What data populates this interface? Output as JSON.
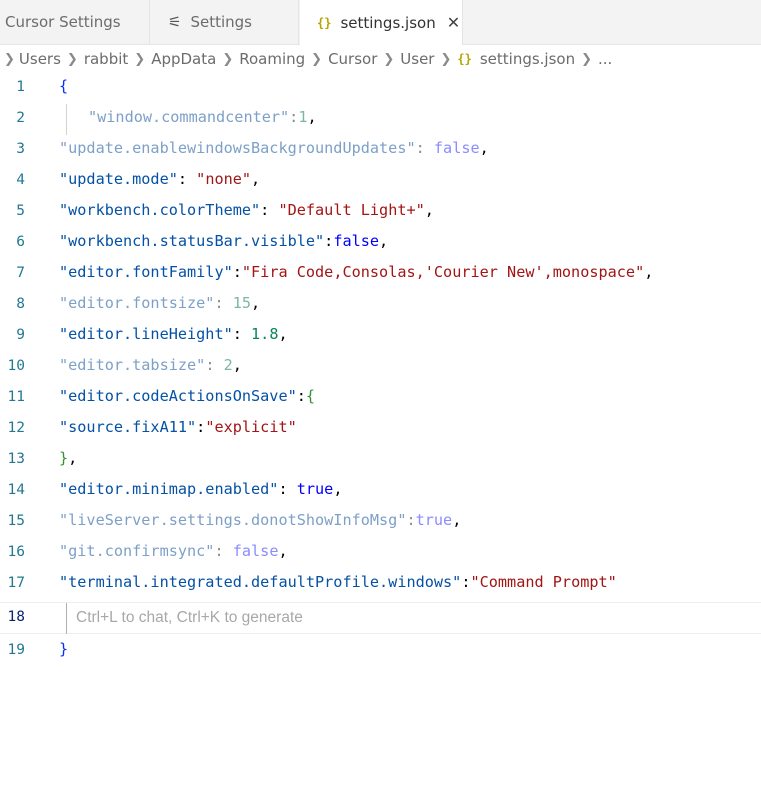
{
  "tabs": [
    {
      "label": "Cursor Settings"
    },
    {
      "label": "Settings",
      "icon": "sliders-icon"
    },
    {
      "label": "settings.json",
      "icon": "json-braces-icon",
      "close": "✕"
    }
  ],
  "breadcrumb": [
    "Users",
    "rabbit",
    "AppData",
    "Roaming",
    "Cursor",
    "User",
    "settings.json",
    "..."
  ],
  "editor": {
    "line_numbers": [
      "1",
      "2",
      "3",
      "4",
      "5",
      "6",
      "7",
      "8",
      "9",
      "10",
      "11",
      "12",
      "13",
      "14",
      "15",
      "16",
      "17",
      "18",
      "19"
    ],
    "inline_hint": "Ctrl+L to chat, Ctrl+K to generate",
    "lines": {
      "l1": {
        "brace": "{"
      },
      "l2": {
        "key": "\"window.commandcenter\"",
        "sep": ":",
        "val": "1",
        "end": ","
      },
      "l3": {
        "key": "\"update.enablewindowsBackgroundUpdates\"",
        "sep": ": ",
        "val": "false",
        "end": ","
      },
      "l4": {
        "key": "\"update.mode\"",
        "sep": ": ",
        "val": "\"none\"",
        "end": ","
      },
      "l5": {
        "key": "\"workbench.colorTheme\"",
        "sep": ": ",
        "val": "\"Default Light+\"",
        "end": ","
      },
      "l6": {
        "key": "\"workbench.statusBar.visible\"",
        "sep": ":",
        "val": "false",
        "end": ","
      },
      "l7": {
        "key": "\"editor.fontFamily\"",
        "sep": ":",
        "val": "\"Fira Code,Consolas,'Courier New',monospace\"",
        "end": ","
      },
      "l8": {
        "key": "\"editor.fontsize\"",
        "sep": ": ",
        "val": "15",
        "end": ","
      },
      "l9": {
        "key": "\"editor.lineHeight\"",
        "sep": ": ",
        "val": "1.8",
        "end": ","
      },
      "l10": {
        "key": "\"editor.tabsize\"",
        "sep": ": ",
        "val": "2",
        "end": ","
      },
      "l11": {
        "key": "\"editor.codeActionsOnSave\"",
        "sep": ":",
        "val": "{"
      },
      "l12": {
        "key": "\"source.fixA11\"",
        "sep": ":",
        "val": "\"explicit\""
      },
      "l13": {
        "val": "}",
        "end": ","
      },
      "l14": {
        "key": "\"editor.minimap.enabled\"",
        "sep": ": ",
        "val": "true",
        "end": ","
      },
      "l15": {
        "key": "\"liveServer.settings.donotShowInfoMsg\"",
        "sep": ":",
        "val": "true",
        "end": ","
      },
      "l16": {
        "key": "\"git.confirmsync\"",
        "sep": ": ",
        "val": "false",
        "end": ","
      },
      "l17": {
        "key": "\"terminal.integrated.defaultProfile.windows\"",
        "sep": ":",
        "val": "\"Command Prompt\""
      },
      "l19": {
        "brace": "}"
      }
    }
  },
  "colors": {
    "key": "#0451a5",
    "string": "#a31515",
    "boolean": "#0000ff",
    "number": "#098658",
    "line_number": "#237893",
    "tab_bar": "#f3f3f3"
  }
}
